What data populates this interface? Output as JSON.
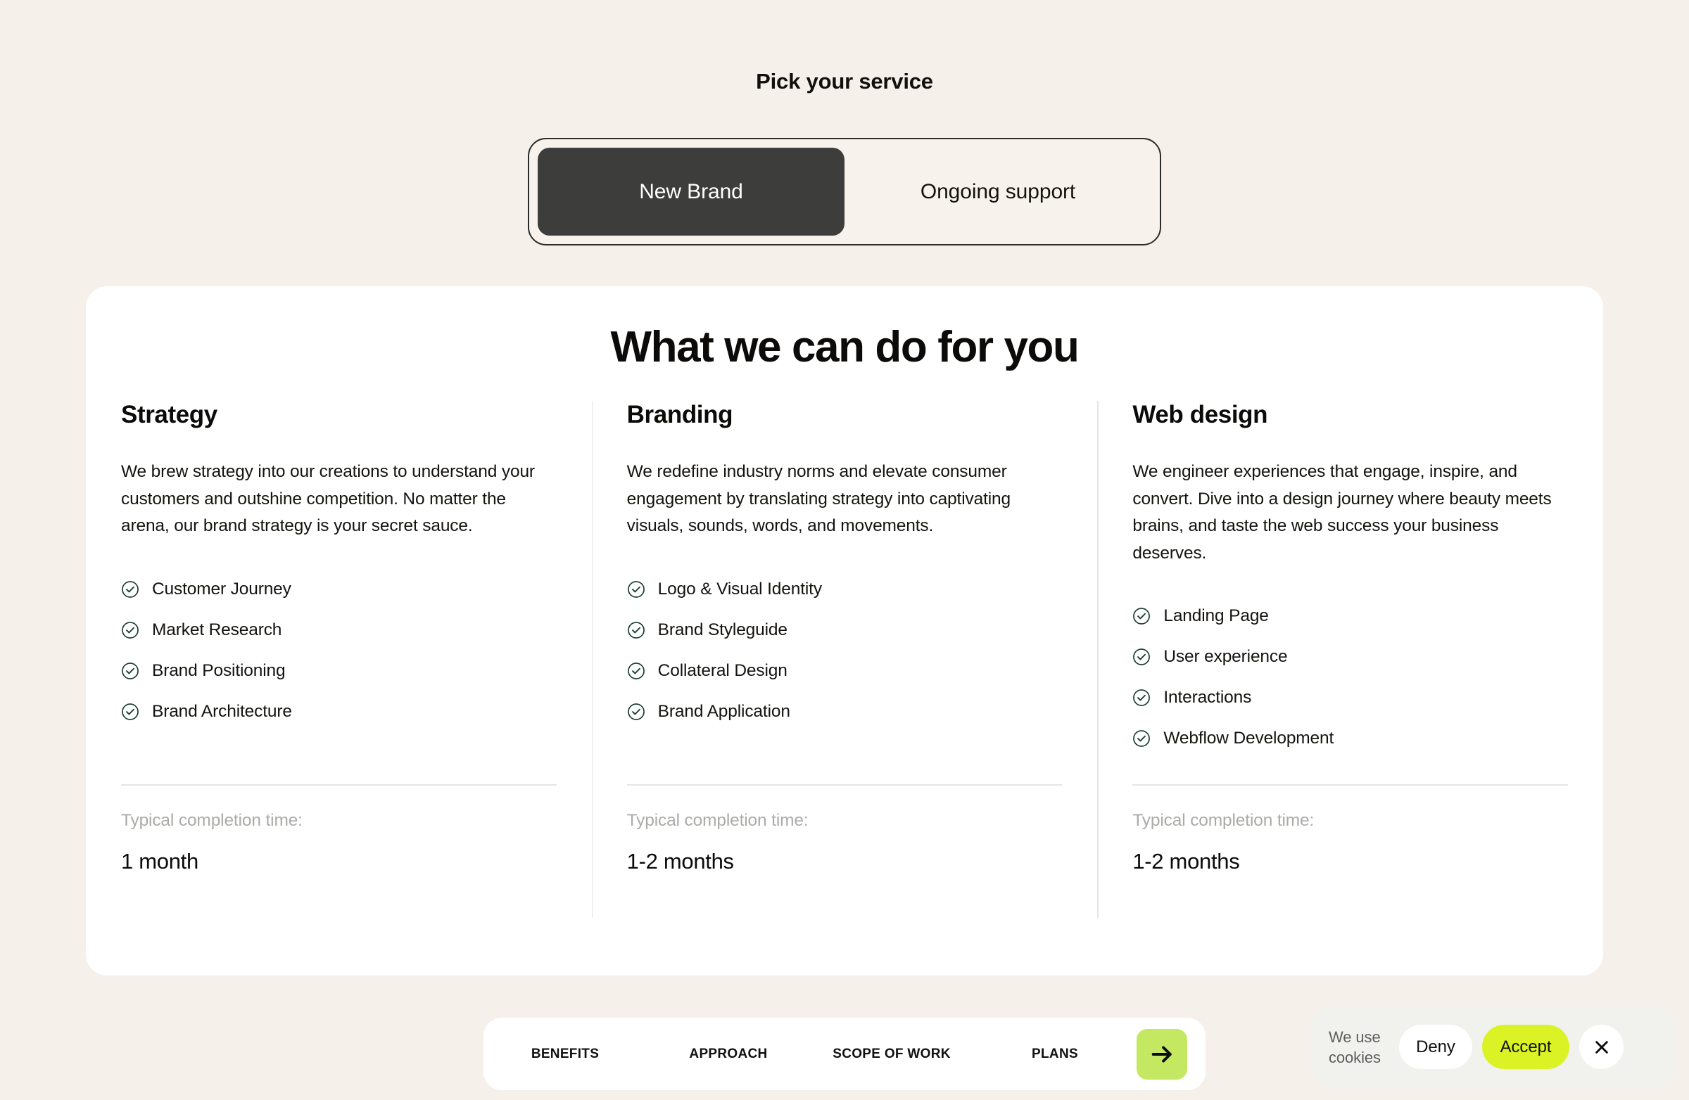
{
  "header": {
    "pick_title": "Pick your service"
  },
  "segmented": {
    "options": [
      {
        "label": "New Brand",
        "active": true
      },
      {
        "label": "Ongoing support",
        "active": false
      }
    ]
  },
  "card": {
    "title": "What we can do for you",
    "time_label": "Typical completion time:",
    "columns": [
      {
        "title": "Strategy",
        "description": "We brew strategy into our creations to understand your customers and outshine competition. No matter the arena, our brand strategy is your secret sauce.",
        "features": [
          "Customer Journey",
          "Market Research",
          "Brand Positioning",
          "Brand Architecture"
        ],
        "time_label": "Typical completion time:",
        "time_value": "1 month"
      },
      {
        "title": "Branding",
        "description": "We redefine industry norms and elevate consumer engagement by translating strategy into captivating visuals, sounds, words, and movements.",
        "features": [
          "Logo & Visual Identity",
          "Brand Styleguide",
          "Collateral Design",
          "Brand Application"
        ],
        "time_label": "Typical completion time:",
        "time_value": "1-2 months"
      },
      {
        "title": "Web design",
        "description": "We engineer experiences that engage, inspire, and convert. Dive into a design journey where beauty meets brains, and taste the web success your business deserves.",
        "features": [
          "Landing Page",
          "User experience",
          "Interactions",
          "Webflow Development"
        ],
        "time_label": "Typical completion time:",
        "time_value": "1-2 months"
      }
    ]
  },
  "bottom_nav": {
    "links": [
      "BENEFITS",
      "APPROACH",
      "SCOPE OF WORK",
      "PLANS"
    ],
    "arrow_icon": "arrow-right-icon"
  },
  "cookie_bar": {
    "message": "We use cookies",
    "deny_label": "Deny",
    "accept_label": "Accept",
    "close_icon": "close-icon"
  },
  "colors": {
    "page_background": "#F5F1EA",
    "card_background": "#FFFFFF",
    "toggle_active": "#3D3D3B",
    "accent_green": "#DBF225",
    "arrow_green": "#C5E863",
    "check_green": "#1E4034",
    "muted_text": "#ABABA8"
  }
}
